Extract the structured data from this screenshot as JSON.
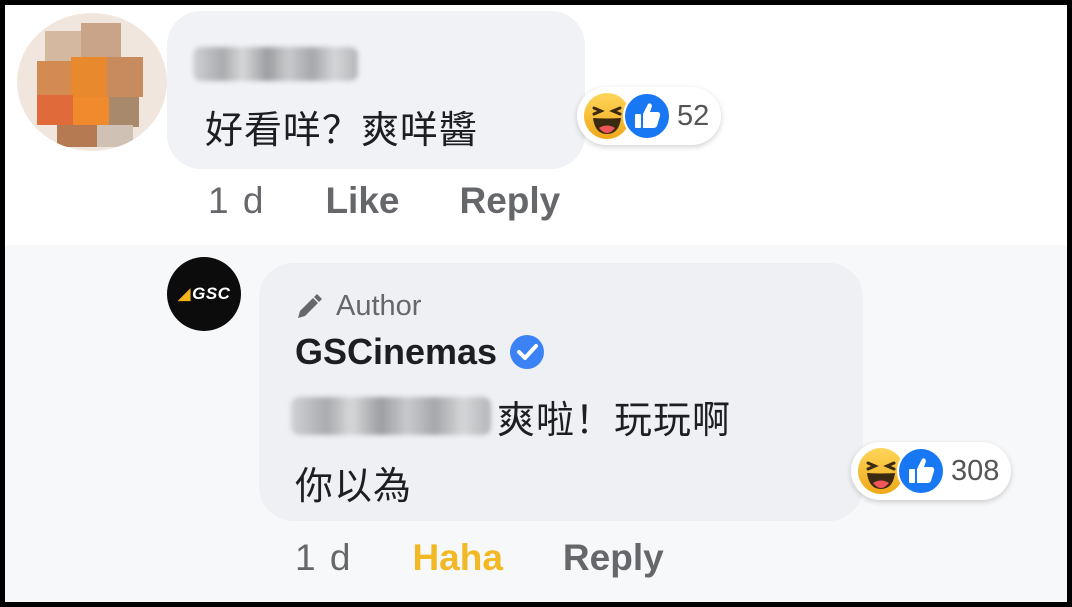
{
  "comment": {
    "text": "好看咩？爽咩醬",
    "reactions": {
      "icons": [
        "haha-icon",
        "like-icon"
      ],
      "count": "52"
    },
    "actions": {
      "time": "1 d",
      "like": "Like",
      "reply": "Reply"
    }
  },
  "reply": {
    "author_badge": "Author",
    "author_name": "GSCinemas",
    "avatar_text": "GSC",
    "text_line1": "爽啦！玩玩啊",
    "text_line2": "你以為",
    "reactions": {
      "icons": [
        "haha-icon",
        "like-icon"
      ],
      "count": "308"
    },
    "actions": {
      "time": "1 d",
      "reaction": "Haha",
      "reply": "Reply"
    }
  },
  "colors": {
    "haha": "#f2b925",
    "like": "#1877f2",
    "verified": "#3b82f6",
    "meta_text": "#65676b"
  }
}
